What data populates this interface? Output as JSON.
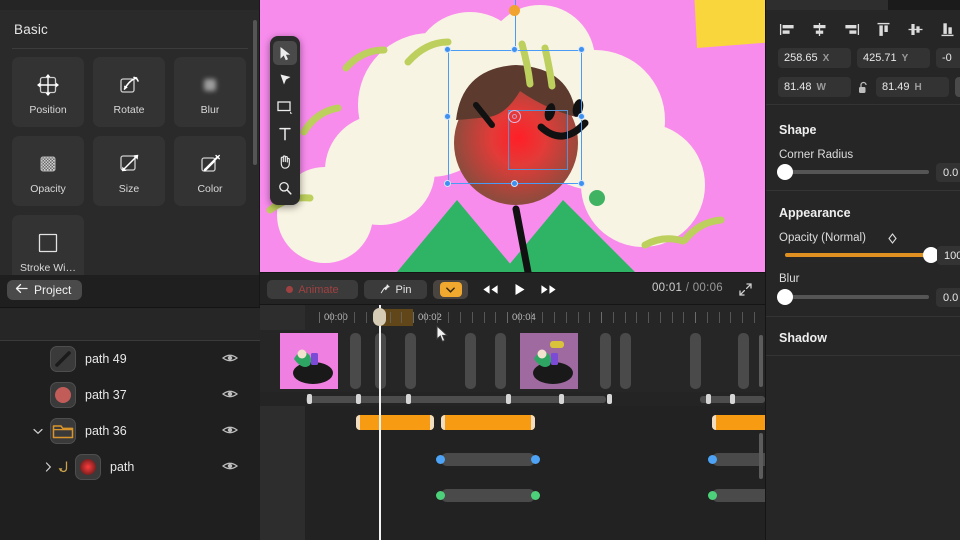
{
  "app": {
    "canvas_bg": "#f88ced",
    "accent_orange": "#f79c12",
    "select_blue": "#4a9bf5"
  },
  "left_panel": {
    "title": "Basic",
    "properties": [
      {
        "label": "Position",
        "icon": "position-icon"
      },
      {
        "label": "Rotate",
        "icon": "rotate-icon"
      },
      {
        "label": "Blur",
        "icon": "blur-icon"
      },
      {
        "label": "Opacity",
        "icon": "opacity-icon"
      },
      {
        "label": "Size",
        "icon": "size-icon"
      },
      {
        "label": "Color",
        "icon": "color-eyedropper-icon"
      },
      {
        "label": "Stroke Wi…",
        "icon": "stroke-width-icon"
      }
    ]
  },
  "tools": [
    {
      "name": "select-arrow-tool",
      "glyph": "arrow",
      "active": true
    },
    {
      "name": "direct-select-tool",
      "glyph": "arrow2",
      "active": false
    },
    {
      "name": "rectangle-tool",
      "glyph": "rect",
      "active": false
    },
    {
      "name": "text-tool",
      "glyph": "T",
      "active": false
    },
    {
      "name": "hand-tool",
      "glyph": "hand",
      "active": false
    },
    {
      "name": "zoom-tool",
      "glyph": "magnify",
      "active": false
    }
  ],
  "inspector": {
    "align_buttons": [
      "align-left-icon",
      "align-center-horizontal-icon",
      "align-right-icon",
      "align-top-icon",
      "align-center-vertical-icon",
      "align-bottom-icon"
    ],
    "transform": {
      "x_value": "258.65",
      "x_unit": "X",
      "y_value": "425.71",
      "y_unit": "Y",
      "rotation_value": "-0",
      "w_value": "81.48",
      "w_unit": "W",
      "h_value": "81.49",
      "h_unit": "H",
      "lock_icon": "unlocked-icon",
      "flip_icon": "flip-horizontal-icon"
    },
    "shape": {
      "title": "Shape",
      "corner_radius_label": "Corner Radius",
      "corner_radius_value": "0.0",
      "corner_radius_pct": 0
    },
    "appearance": {
      "title": "Appearance",
      "opacity_label": "Opacity (Normal)",
      "opacity_value": "100",
      "opacity_pct": 100,
      "blur_label": "Blur",
      "blur_value": "0.0",
      "blur_pct": 0
    },
    "shadow": {
      "title": "Shadow"
    }
  },
  "playbar": {
    "animate_label": "Animate",
    "pin_label": "Pin",
    "pin_icon": "pushpin-icon",
    "dropdown_icon": "chevron-down-icon",
    "rewind_icon": "rewind-icon",
    "play_icon": "play-icon",
    "fastforward_icon": "fast-forward-icon",
    "current_time": "00:01",
    "separator": "/",
    "total_time": "00:06",
    "expand_icon": "expand-fullscreen-icon"
  },
  "layers": {
    "back_label": "Project",
    "back_icon": "arrow-left-icon",
    "rows": [
      {
        "name": "path 49",
        "thumb": "diagonal-stroke",
        "indent": 0,
        "twisty": "",
        "eye": "eye-icon"
      },
      {
        "name": "path 37",
        "thumb": "red-circle",
        "indent": 0,
        "twisty": "",
        "eye": "eye-icon"
      },
      {
        "name": "path 36",
        "thumb": "folder",
        "indent": 0,
        "twisty": "down",
        "eye": "eye-icon"
      },
      {
        "name": "path",
        "thumb": "red-glow-circle",
        "indent": 1,
        "twisty": "right",
        "eye": "eye-icon"
      }
    ]
  },
  "timeline": {
    "tick_labels": [
      "00:00",
      "00:02",
      "00:04"
    ],
    "playhead_time": "00:01",
    "keyframe_bars": [
      {
        "start_pct": 11.0,
        "width_pct": 17.0
      },
      {
        "start_pct": 29.5,
        "width_pct": 20.5
      },
      {
        "start_pct": 88.5,
        "width_pct": 13.0
      }
    ],
    "blue_track": {
      "segments": [
        {
          "start_pct": 29.5,
          "width_pct": 20.5
        },
        {
          "start_pct": 88.5,
          "width_pct": 13.0
        }
      ],
      "color": "#4da3f5"
    },
    "green_track": {
      "segments": [
        {
          "start_pct": 29.5,
          "width_pct": 20.5
        },
        {
          "start_pct": 88.5,
          "width_pct": 13.0
        }
      ],
      "color": "#4dd07a"
    }
  }
}
